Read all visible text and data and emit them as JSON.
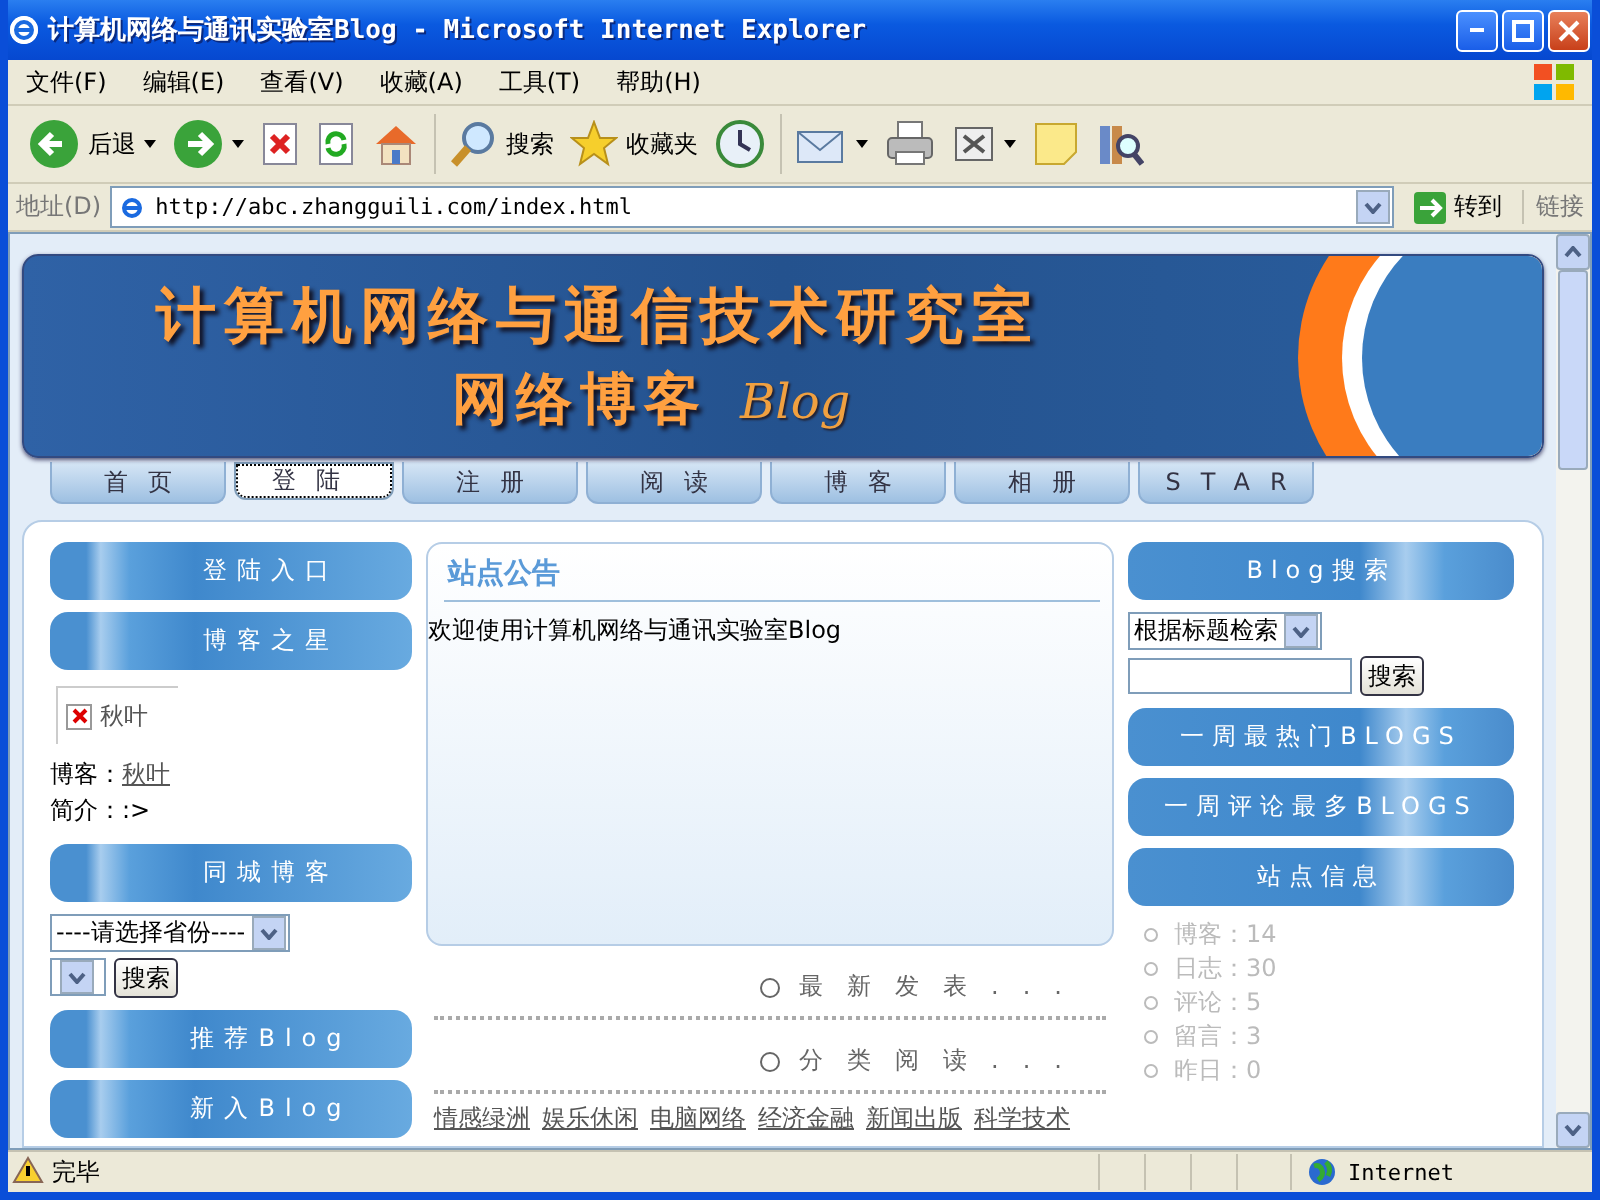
{
  "window": {
    "title": "计算机网络与通讯实验室Blog - Microsoft Internet Explorer"
  },
  "menu": [
    "文件(F)",
    "编辑(E)",
    "查看(V)",
    "收藏(A)",
    "工具(T)",
    "帮助(H)"
  ],
  "toolbar": [
    {
      "kind": "back",
      "label": "后退"
    },
    {
      "kind": "forward"
    },
    {
      "kind": "stop"
    },
    {
      "kind": "refresh"
    },
    {
      "kind": "home"
    },
    {
      "kind": "search",
      "label": "搜索"
    },
    {
      "kind": "favorites",
      "label": "收藏夹"
    },
    {
      "kind": "history"
    },
    {
      "kind": "mail"
    },
    {
      "kind": "print"
    },
    {
      "kind": "edit"
    },
    {
      "kind": "note"
    },
    {
      "kind": "research"
    }
  ],
  "address": {
    "label": "地址(D)",
    "url": "http://abc.zhangguili.com/index.html",
    "go": "转到",
    "links": "链接"
  },
  "banner": {
    "title": "计算机网络与通信技术研究室",
    "subtitle": "网络博客",
    "subtitle_latin": "Blog"
  },
  "nav": [
    {
      "label": "首页",
      "selected": false
    },
    {
      "label": "登陆",
      "selected": true
    },
    {
      "label": "注册",
      "selected": false
    },
    {
      "label": "阅读",
      "selected": false
    },
    {
      "label": "博客",
      "selected": false
    },
    {
      "label": "相册",
      "selected": false
    },
    {
      "label": "STAR",
      "selected": false
    }
  ],
  "left": [
    {
      "kind": "header",
      "label": "登陆入口"
    },
    {
      "kind": "header",
      "label": "博客之星"
    },
    {
      "kind": "star",
      "image_alt": "秋叶",
      "blogger_label": "博客：",
      "blogger": "秋叶",
      "intro": "简介：:>"
    },
    {
      "kind": "header",
      "label": "同城博客"
    },
    {
      "kind": "city",
      "province": "----请选择省份----",
      "button": "搜索"
    },
    {
      "kind": "header",
      "label": "推荐Blog"
    },
    {
      "kind": "header",
      "label": "新入Blog"
    }
  ],
  "notice": {
    "title": "站点公告",
    "text": "欢迎使用计算机网络与通讯实验室Blog"
  },
  "center_sections": [
    {
      "title": "最新发表..."
    },
    {
      "title": "分类阅读..."
    }
  ],
  "categories": [
    "情感绿洲",
    "娱乐休闲",
    "电脑网络",
    "经济金融",
    "新闻出版",
    "科学技术"
  ],
  "right": [
    {
      "kind": "header",
      "label": "Blog搜索"
    },
    {
      "kind": "search",
      "select": "根据标题检索",
      "button": "搜索"
    },
    {
      "kind": "header",
      "label": "一周最热门BLOGS"
    },
    {
      "kind": "header",
      "label": "一周评论最多BLOGS"
    },
    {
      "kind": "header",
      "label": "站点信息"
    },
    {
      "kind": "stats",
      "items": [
        "博客：14",
        "日志：30",
        "评论：5",
        "留言：3",
        "昨日：0"
      ]
    }
  ],
  "status": {
    "text": "完毕",
    "zone": "Internet"
  }
}
